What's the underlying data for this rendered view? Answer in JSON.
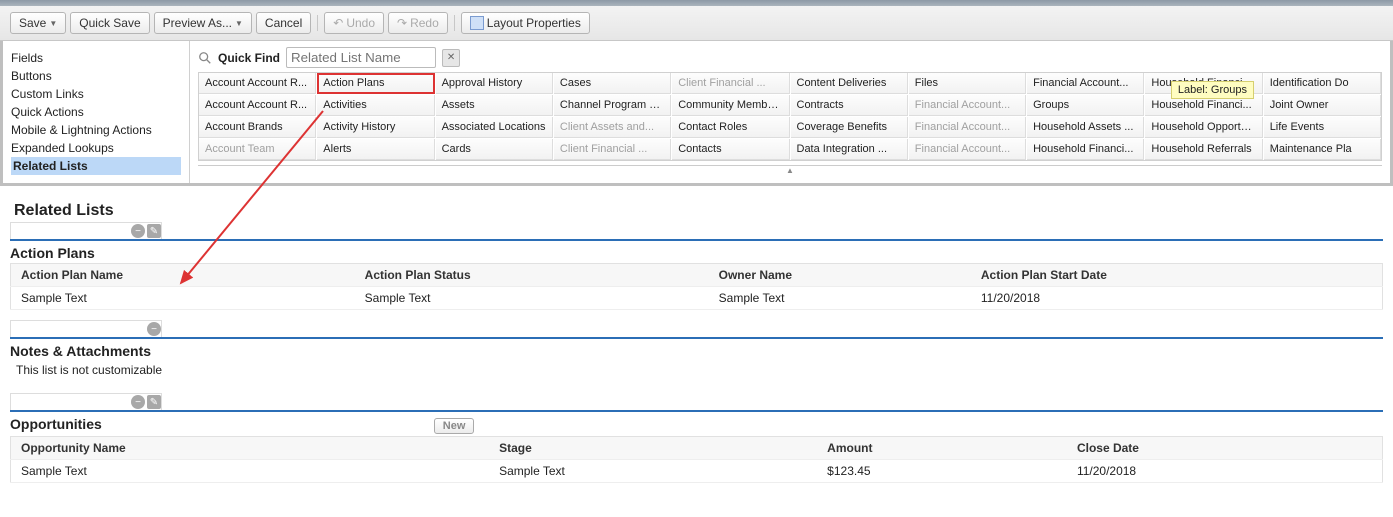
{
  "toolbar": {
    "save": "Save",
    "quick_save": "Quick Save",
    "preview_as": "Preview As...",
    "cancel": "Cancel",
    "undo": "Undo",
    "redo": "Redo",
    "layout_props": "Layout Properties"
  },
  "left_nav": {
    "items": [
      "Fields",
      "Buttons",
      "Custom Links",
      "Quick Actions",
      "Mobile & Lightning Actions",
      "Expanded Lookups",
      "Related Lists"
    ],
    "selected_index": 6
  },
  "quick_find": {
    "label": "Quick Find",
    "placeholder": "Related List Name"
  },
  "palette": {
    "rows": [
      [
        {
          "t": "Account Account R...",
          "dim": false
        },
        {
          "t": "Action Plans",
          "dim": false,
          "highlight": true
        },
        {
          "t": "Approval History",
          "dim": false
        },
        {
          "t": "Cases",
          "dim": false
        },
        {
          "t": "Client Financial ...",
          "dim": true
        },
        {
          "t": "Content Deliveries",
          "dim": false
        },
        {
          "t": "Files",
          "dim": false
        },
        {
          "t": "Financial Account...",
          "dim": false
        },
        {
          "t": "Household Financi...",
          "dim": false
        },
        {
          "t": "Identification Do",
          "dim": false
        }
      ],
      [
        {
          "t": "Account Account R...",
          "dim": false
        },
        {
          "t": "Activities",
          "dim": false
        },
        {
          "t": "Assets",
          "dim": false
        },
        {
          "t": "Channel Program M...",
          "dim": false
        },
        {
          "t": "Community Members",
          "dim": false
        },
        {
          "t": "Contracts",
          "dim": false
        },
        {
          "t": "Financial Account...",
          "dim": true
        },
        {
          "t": "Groups",
          "dim": false
        },
        {
          "t": "Household Financi...",
          "dim": false
        },
        {
          "t": "Joint Owner",
          "dim": false
        }
      ],
      [
        {
          "t": "Account Brands",
          "dim": false
        },
        {
          "t": "Activity History",
          "dim": false
        },
        {
          "t": "Associated Locations",
          "dim": false
        },
        {
          "t": "Client Assets and...",
          "dim": true
        },
        {
          "t": "Contact Roles",
          "dim": false
        },
        {
          "t": "Coverage Benefits",
          "dim": false
        },
        {
          "t": "Financial Account...",
          "dim": true
        },
        {
          "t": "Household Assets ...",
          "dim": false
        },
        {
          "t": "Household Opportu...",
          "dim": false
        },
        {
          "t": "Life Events",
          "dim": false
        }
      ],
      [
        {
          "t": "Account Team",
          "dim": true
        },
        {
          "t": "Alerts",
          "dim": false
        },
        {
          "t": "Cards",
          "dim": false
        },
        {
          "t": "Client Financial ...",
          "dim": true
        },
        {
          "t": "Contacts",
          "dim": false
        },
        {
          "t": "Data Integration ...",
          "dim": false
        },
        {
          "t": "Financial Account...",
          "dim": true
        },
        {
          "t": "Household Financi...",
          "dim": false
        },
        {
          "t": "Household Referrals",
          "dim": false
        },
        {
          "t": "Maintenance Pla",
          "dim": false
        }
      ]
    ]
  },
  "tooltip": {
    "text": "Label: Groups"
  },
  "related_lists": {
    "title": "Related Lists",
    "action_plans": {
      "name": "Action Plans",
      "cols": [
        "Action Plan Name",
        "Action Plan Status",
        "Owner Name",
        "Action Plan Start Date"
      ],
      "row": [
        "Sample Text",
        "Sample Text",
        "Sample Text",
        "11/20/2018"
      ]
    },
    "notes": {
      "name": "Notes & Attachments",
      "sub": "This list is not customizable"
    },
    "opps": {
      "name": "Opportunities",
      "new_btn": "New",
      "cols": [
        "Opportunity Name",
        "Stage",
        "Amount",
        "Close Date"
      ],
      "row": [
        "Sample Text",
        "Sample Text",
        "$123.45",
        "11/20/2018"
      ]
    }
  }
}
